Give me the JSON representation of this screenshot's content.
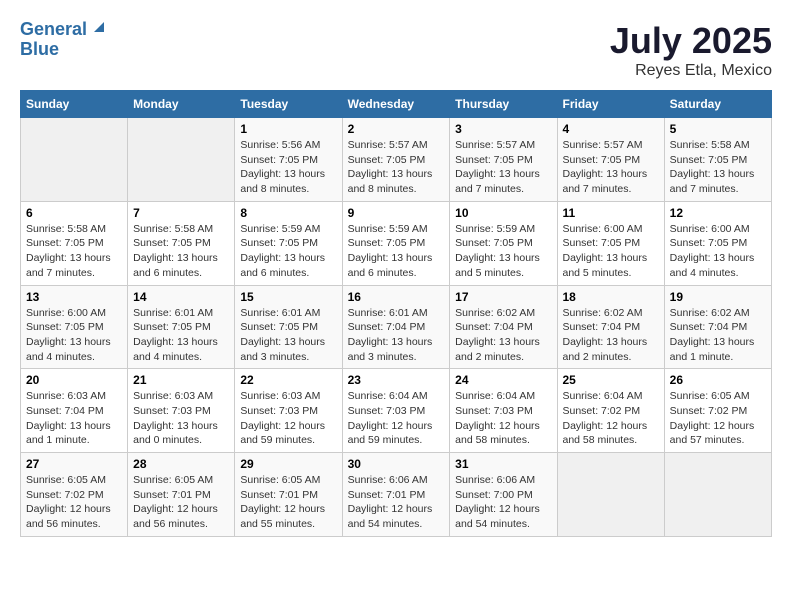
{
  "header": {
    "logo_line1": "General",
    "logo_line2": "Blue",
    "title": "July 2025",
    "subtitle": "Reyes Etla, Mexico"
  },
  "days_of_week": [
    "Sunday",
    "Monday",
    "Tuesday",
    "Wednesday",
    "Thursday",
    "Friday",
    "Saturday"
  ],
  "weeks": [
    [
      {
        "day": "",
        "info": ""
      },
      {
        "day": "",
        "info": ""
      },
      {
        "day": "1",
        "info": "Sunrise: 5:56 AM\nSunset: 7:05 PM\nDaylight: 13 hours and 8 minutes."
      },
      {
        "day": "2",
        "info": "Sunrise: 5:57 AM\nSunset: 7:05 PM\nDaylight: 13 hours and 8 minutes."
      },
      {
        "day": "3",
        "info": "Sunrise: 5:57 AM\nSunset: 7:05 PM\nDaylight: 13 hours and 7 minutes."
      },
      {
        "day": "4",
        "info": "Sunrise: 5:57 AM\nSunset: 7:05 PM\nDaylight: 13 hours and 7 minutes."
      },
      {
        "day": "5",
        "info": "Sunrise: 5:58 AM\nSunset: 7:05 PM\nDaylight: 13 hours and 7 minutes."
      }
    ],
    [
      {
        "day": "6",
        "info": "Sunrise: 5:58 AM\nSunset: 7:05 PM\nDaylight: 13 hours and 7 minutes."
      },
      {
        "day": "7",
        "info": "Sunrise: 5:58 AM\nSunset: 7:05 PM\nDaylight: 13 hours and 6 minutes."
      },
      {
        "day": "8",
        "info": "Sunrise: 5:59 AM\nSunset: 7:05 PM\nDaylight: 13 hours and 6 minutes."
      },
      {
        "day": "9",
        "info": "Sunrise: 5:59 AM\nSunset: 7:05 PM\nDaylight: 13 hours and 6 minutes."
      },
      {
        "day": "10",
        "info": "Sunrise: 5:59 AM\nSunset: 7:05 PM\nDaylight: 13 hours and 5 minutes."
      },
      {
        "day": "11",
        "info": "Sunrise: 6:00 AM\nSunset: 7:05 PM\nDaylight: 13 hours and 5 minutes."
      },
      {
        "day": "12",
        "info": "Sunrise: 6:00 AM\nSunset: 7:05 PM\nDaylight: 13 hours and 4 minutes."
      }
    ],
    [
      {
        "day": "13",
        "info": "Sunrise: 6:00 AM\nSunset: 7:05 PM\nDaylight: 13 hours and 4 minutes."
      },
      {
        "day": "14",
        "info": "Sunrise: 6:01 AM\nSunset: 7:05 PM\nDaylight: 13 hours and 4 minutes."
      },
      {
        "day": "15",
        "info": "Sunrise: 6:01 AM\nSunset: 7:05 PM\nDaylight: 13 hours and 3 minutes."
      },
      {
        "day": "16",
        "info": "Sunrise: 6:01 AM\nSunset: 7:04 PM\nDaylight: 13 hours and 3 minutes."
      },
      {
        "day": "17",
        "info": "Sunrise: 6:02 AM\nSunset: 7:04 PM\nDaylight: 13 hours and 2 minutes."
      },
      {
        "day": "18",
        "info": "Sunrise: 6:02 AM\nSunset: 7:04 PM\nDaylight: 13 hours and 2 minutes."
      },
      {
        "day": "19",
        "info": "Sunrise: 6:02 AM\nSunset: 7:04 PM\nDaylight: 13 hours and 1 minute."
      }
    ],
    [
      {
        "day": "20",
        "info": "Sunrise: 6:03 AM\nSunset: 7:04 PM\nDaylight: 13 hours and 1 minute."
      },
      {
        "day": "21",
        "info": "Sunrise: 6:03 AM\nSunset: 7:03 PM\nDaylight: 13 hours and 0 minutes."
      },
      {
        "day": "22",
        "info": "Sunrise: 6:03 AM\nSunset: 7:03 PM\nDaylight: 12 hours and 59 minutes."
      },
      {
        "day": "23",
        "info": "Sunrise: 6:04 AM\nSunset: 7:03 PM\nDaylight: 12 hours and 59 minutes."
      },
      {
        "day": "24",
        "info": "Sunrise: 6:04 AM\nSunset: 7:03 PM\nDaylight: 12 hours and 58 minutes."
      },
      {
        "day": "25",
        "info": "Sunrise: 6:04 AM\nSunset: 7:02 PM\nDaylight: 12 hours and 58 minutes."
      },
      {
        "day": "26",
        "info": "Sunrise: 6:05 AM\nSunset: 7:02 PM\nDaylight: 12 hours and 57 minutes."
      }
    ],
    [
      {
        "day": "27",
        "info": "Sunrise: 6:05 AM\nSunset: 7:02 PM\nDaylight: 12 hours and 56 minutes."
      },
      {
        "day": "28",
        "info": "Sunrise: 6:05 AM\nSunset: 7:01 PM\nDaylight: 12 hours and 56 minutes."
      },
      {
        "day": "29",
        "info": "Sunrise: 6:05 AM\nSunset: 7:01 PM\nDaylight: 12 hours and 55 minutes."
      },
      {
        "day": "30",
        "info": "Sunrise: 6:06 AM\nSunset: 7:01 PM\nDaylight: 12 hours and 54 minutes."
      },
      {
        "day": "31",
        "info": "Sunrise: 6:06 AM\nSunset: 7:00 PM\nDaylight: 12 hours and 54 minutes."
      },
      {
        "day": "",
        "info": ""
      },
      {
        "day": "",
        "info": ""
      }
    ]
  ]
}
